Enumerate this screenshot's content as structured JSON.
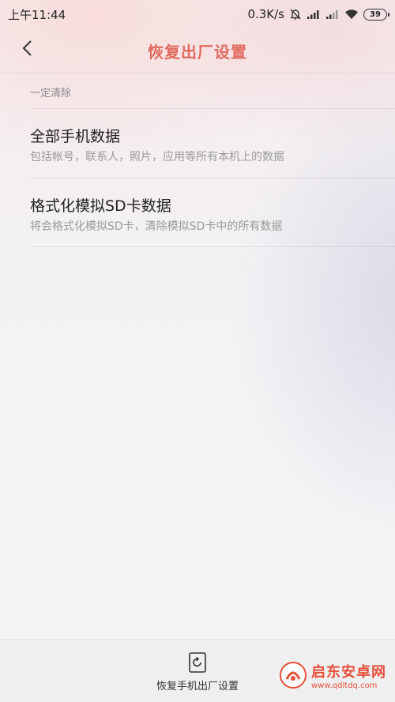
{
  "status_bar": {
    "time": "上午11:44",
    "network_speed": "0.3K/s",
    "battery_level": "39",
    "icons": [
      "mute-bell-icon",
      "signal-icon",
      "signal-icon-2",
      "wifi-icon",
      "battery-icon"
    ]
  },
  "header": {
    "back_icon": "chevron-left-icon",
    "title": "恢复出厂设置",
    "title_color": "#e06a5e"
  },
  "section": {
    "label": "一定清除"
  },
  "items": [
    {
      "title": "全部手机数据",
      "subtitle": "包括帐号，联系人，照片，应用等所有本机上的数据"
    },
    {
      "title": "格式化模拟SD卡数据",
      "subtitle": "将会格式化模拟SD卡，清除模拟SD卡中的所有数据"
    }
  ],
  "bottom": {
    "reset_icon": "reset-icon",
    "reset_label": "恢复手机出厂设置"
  },
  "watermark": {
    "title": "启东安卓网",
    "url": "www.qdltdq.com",
    "color": "#e6503a"
  }
}
